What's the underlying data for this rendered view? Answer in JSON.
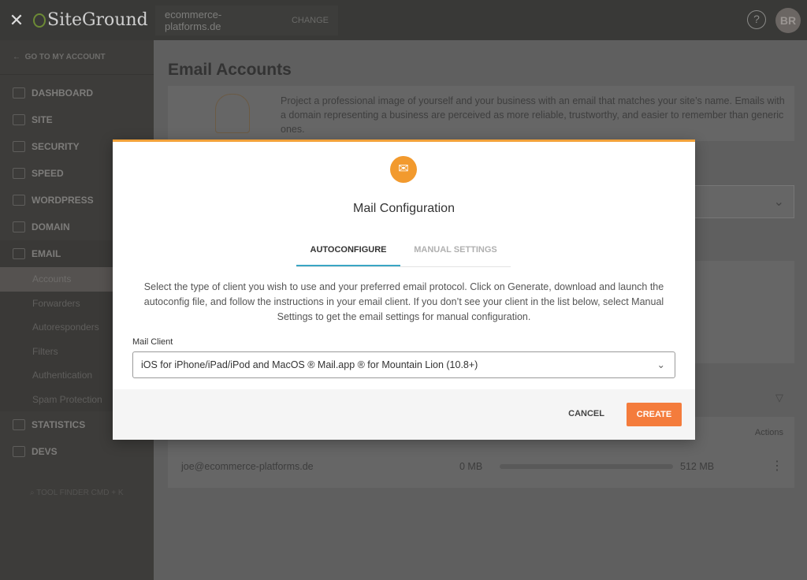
{
  "topbar": {
    "brand": "SiteGround",
    "site": "ecommerce-platforms.de",
    "change": "CHANGE",
    "help": "?",
    "avatar": "BR"
  },
  "sidebar": {
    "back": "GO TO MY ACCOUNT",
    "items": [
      {
        "label": "DASHBOARD",
        "icon": "dashboard-icon"
      },
      {
        "label": "SITE",
        "icon": "site-icon"
      },
      {
        "label": "SECURITY",
        "icon": "lock-icon"
      },
      {
        "label": "SPEED",
        "icon": "rocket-icon"
      },
      {
        "label": "WORDPRESS",
        "icon": "wordpress-icon"
      },
      {
        "label": "DOMAIN",
        "icon": "globe-icon"
      },
      {
        "label": "EMAIL",
        "icon": "envelope-icon"
      }
    ],
    "email_sub": [
      "Accounts",
      "Forwarders",
      "Autoresponders",
      "Filters",
      "Authentication",
      "Spam Protection"
    ],
    "bottom": [
      {
        "label": "STATISTICS",
        "icon": "pie-chart-icon"
      },
      {
        "label": "DEVS",
        "icon": "code-icon"
      }
    ],
    "finder": "TOOL FINDER CMD + K"
  },
  "main": {
    "title": "Email Accounts",
    "intro": "Project a professional image of yourself and your business with an email that matches your site’s name. Emails with a domain representing a business are perceived as more reliable, trustworthy, and easier to remember than generic ones.",
    "actions_header": "Actions",
    "account": {
      "email": "joe@ecommerce-platforms.de",
      "used": "0 MB",
      "quota": "512 MB",
      "usage_percent": 0
    }
  },
  "modal": {
    "title": "Mail Configuration",
    "tabs": [
      "AUTOCONFIGURE",
      "MANUAL SETTINGS"
    ],
    "active_tab": "AUTOCONFIGURE",
    "description": "Select the type of client you wish to use and your preferred email protocol. Click on Generate, download and launch the autoconfig file, and follow the instructions in your email client. If you don’t see your client in the list below, select Manual Settings to get the email settings for manual configuration.",
    "client_label": "Mail Client",
    "client_value": "iOS for iPhone/iPad/iPod and MacOS ® Mail.app ® for Mountain Lion (10.8+)",
    "cancel": "CANCEL",
    "create": "CREATE",
    "accent": "#f29a2e",
    "create_color": "#f47c3c"
  }
}
